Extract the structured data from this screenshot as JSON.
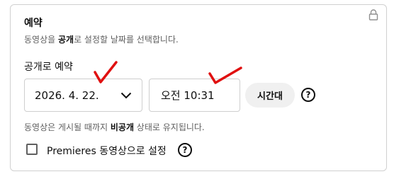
{
  "section": {
    "title": "예약",
    "description_prefix": "동영상을 ",
    "description_bold": "공개",
    "description_suffix": "로 설정할 날짜를 선택합니다."
  },
  "schedule": {
    "label": "공개로 예약",
    "date_value": "2026. 4. 22.",
    "time_value": "오전 10:31",
    "timezone_button": "시간대",
    "help_glyph": "?"
  },
  "note": {
    "prefix": "동영상은 게시될 때까지 ",
    "bold": "비공개",
    "suffix": " 상태로 유지됩니다."
  },
  "premiere": {
    "label": "Premieres 동영상으로 설정",
    "checked": false,
    "help_glyph": "?"
  },
  "icons": {
    "lock": "lock-icon",
    "dropdown": "chevron-down-icon",
    "help": "help-circle-icon",
    "annotation": "red-checkmark"
  },
  "colors": {
    "annotation": "#e01010",
    "border": "#d0d0d0",
    "secondary_text": "#606060",
    "button_bg": "#f0f0f0"
  }
}
